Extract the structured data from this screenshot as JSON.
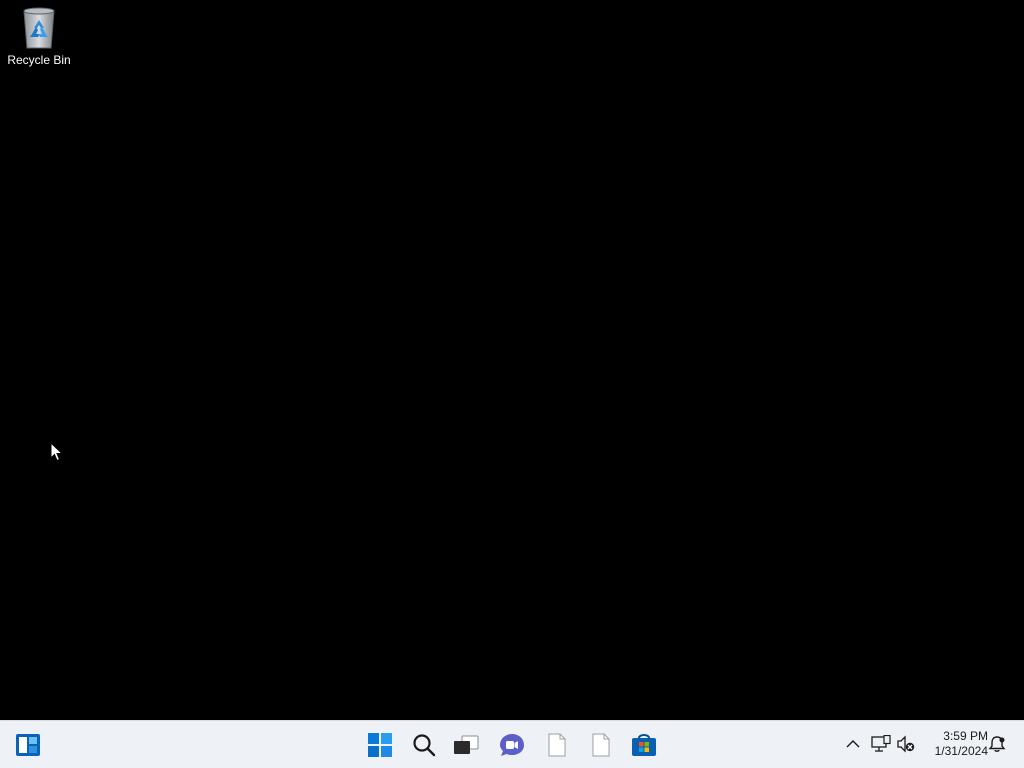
{
  "desktop": {
    "icons": [
      {
        "label": "Recycle Bin",
        "icon": "recycle-bin-icon"
      }
    ]
  },
  "taskbar": {
    "left": [
      {
        "name": "widgets",
        "icon": "widgets-icon"
      }
    ],
    "center": [
      {
        "name": "start",
        "icon": "windows-start-icon"
      },
      {
        "name": "search",
        "icon": "search-icon"
      },
      {
        "name": "task-view",
        "icon": "task-view-icon"
      },
      {
        "name": "chat",
        "icon": "teams-chat-icon"
      },
      {
        "name": "file-1",
        "icon": "blank-file-icon"
      },
      {
        "name": "file-2",
        "icon": "blank-file-icon"
      },
      {
        "name": "store",
        "icon": "microsoft-store-icon"
      }
    ],
    "tray": [
      {
        "name": "show-hidden-icons",
        "icon": "chevron-up-icon"
      },
      {
        "name": "network",
        "icon": "network-disconnected-icon"
      },
      {
        "name": "volume",
        "icon": "speaker-muted-icon"
      },
      {
        "name": "notifications",
        "icon": "notification-bell-icon"
      }
    ],
    "clock": {
      "time": "3:59 PM",
      "date": "1/31/2024"
    }
  },
  "colors": {
    "desktop_background": "#000000",
    "taskbar_background": "#eef1f5",
    "accent_blue": "#0078d4"
  }
}
